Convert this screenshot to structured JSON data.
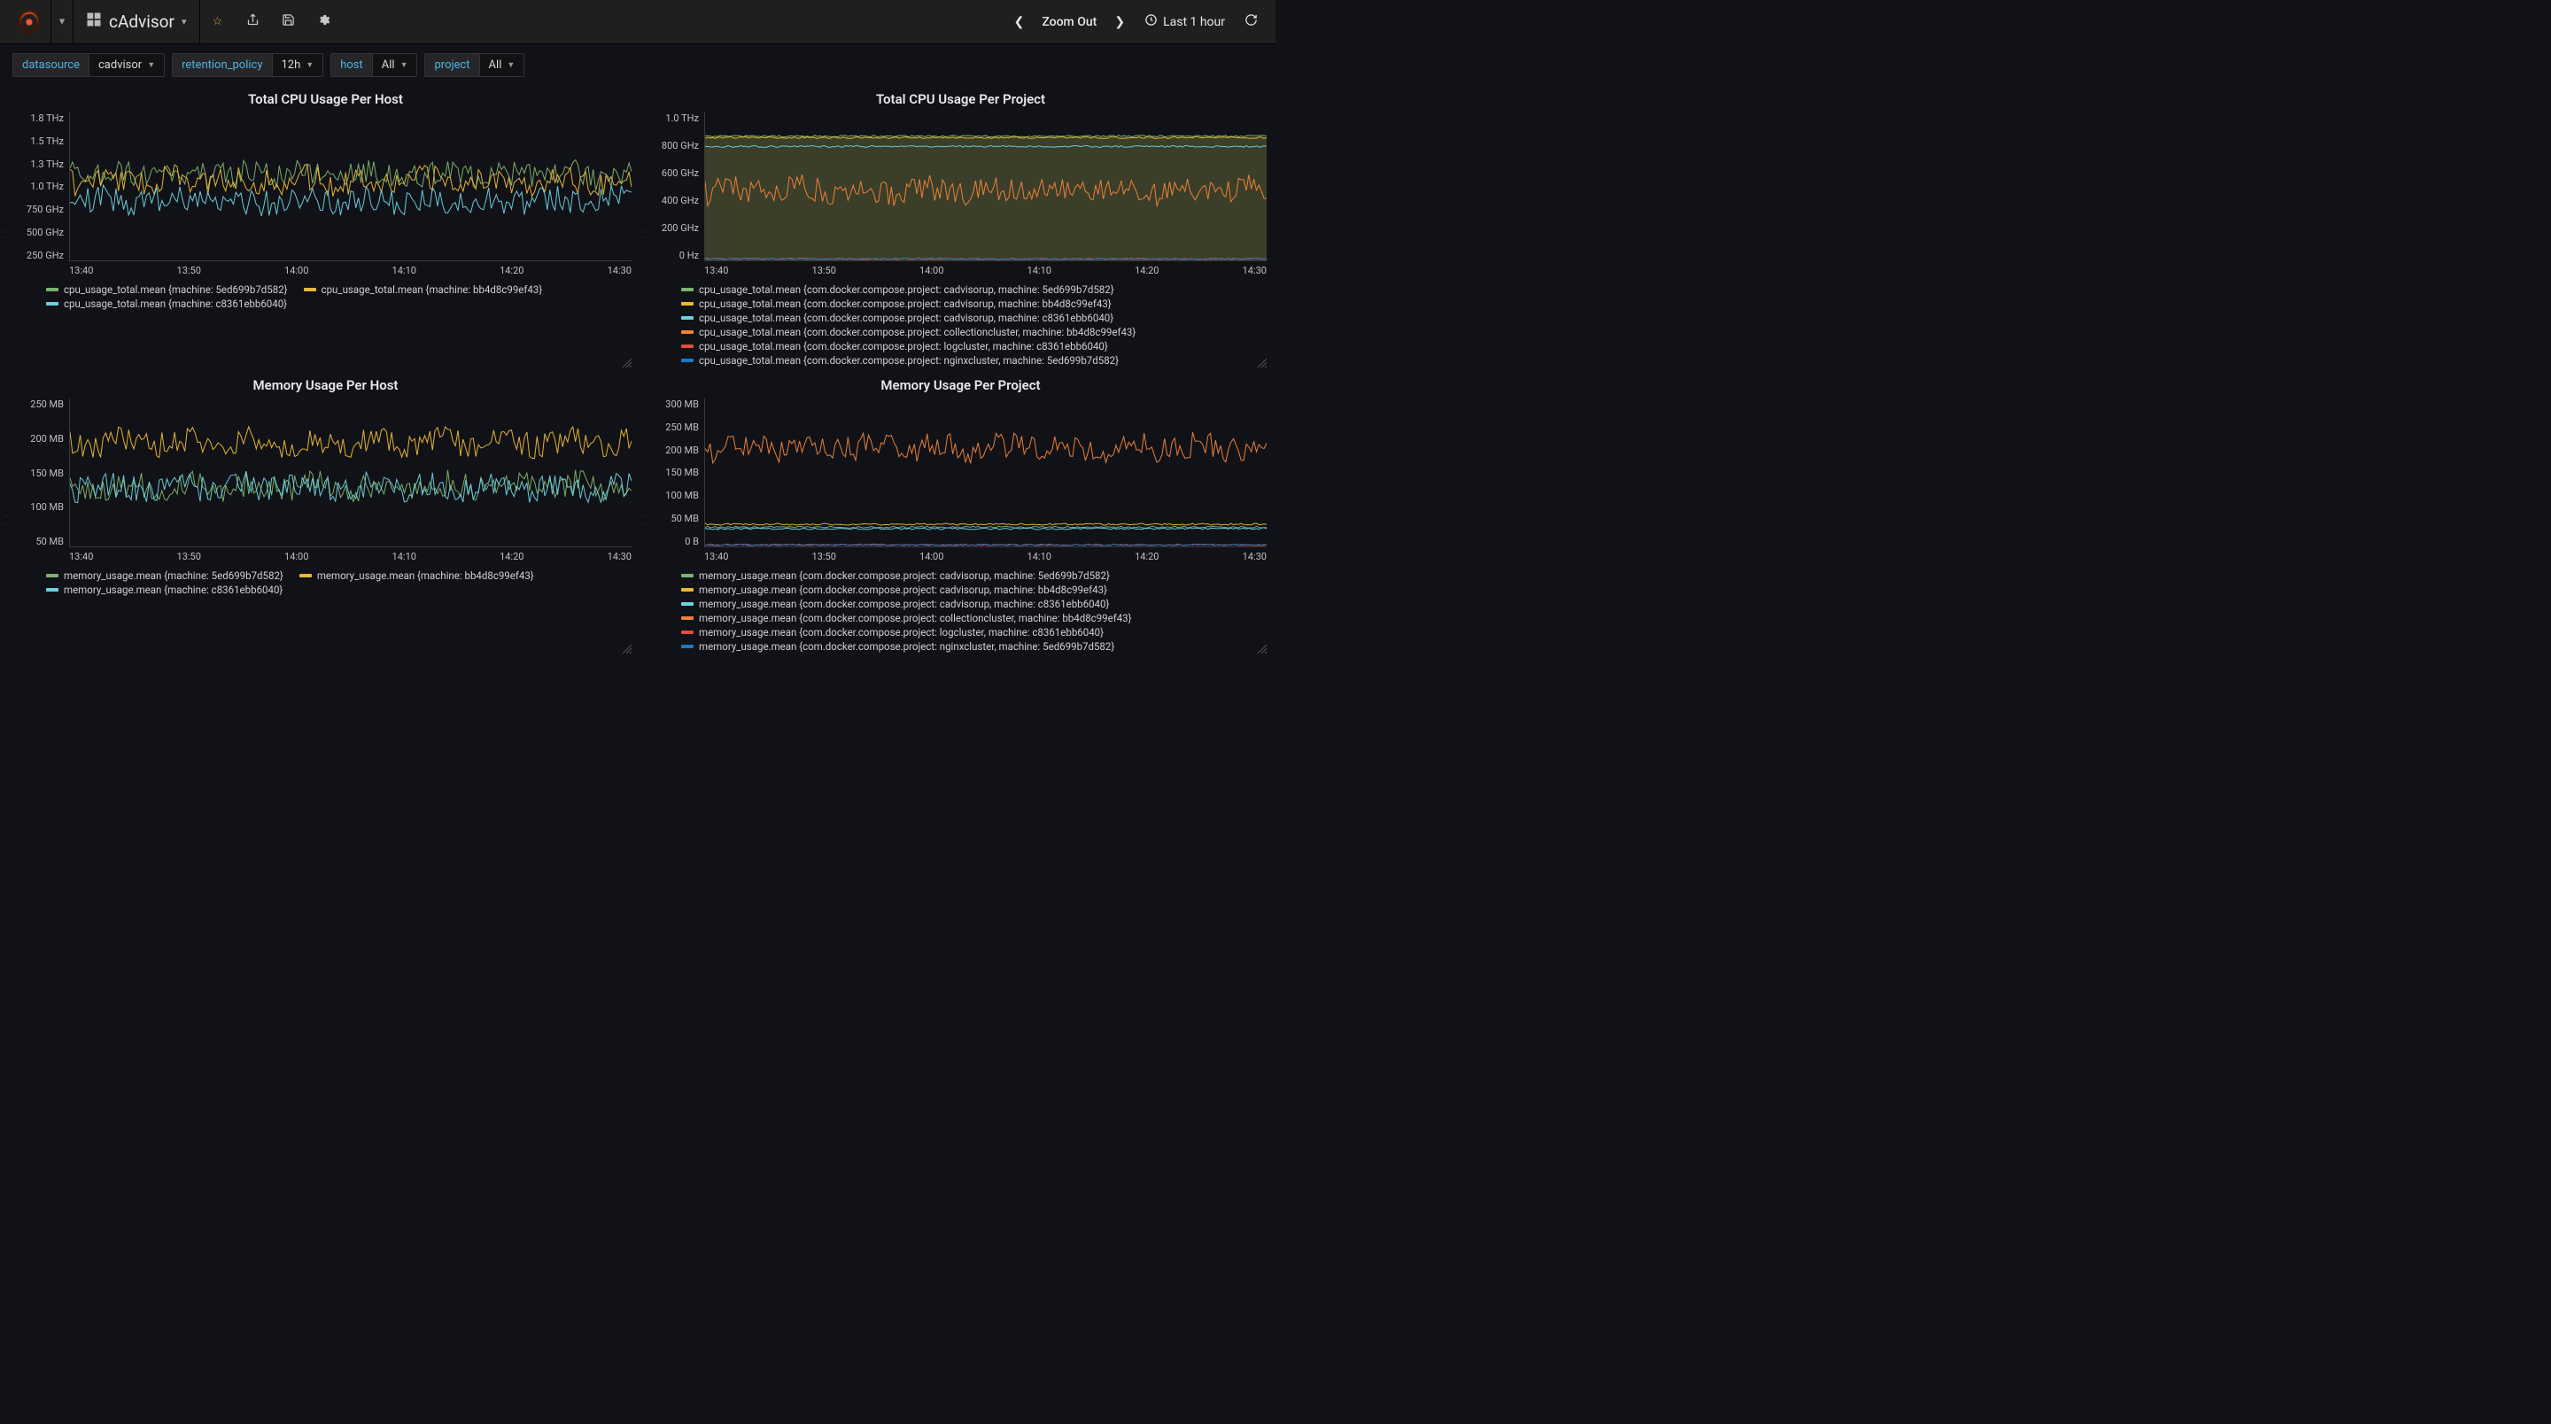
{
  "header": {
    "dashboard_title": "cAdvisor",
    "zoom_label": "Zoom Out",
    "time_label": "Last 1 hour"
  },
  "template_vars": [
    {
      "label": "datasource",
      "value": "cadvisor"
    },
    {
      "label": "retention_policy",
      "value": "12h"
    },
    {
      "label": "host",
      "value": "All"
    },
    {
      "label": "project",
      "value": "All"
    }
  ],
  "colors": {
    "green": "#7eb26d",
    "yellow": "#eab839",
    "cyan": "#6ed0e0",
    "orange": "#ef843c",
    "red": "#e24d42",
    "blue": "#1f78c1"
  },
  "panels": [
    {
      "title": "Total CPU Usage Per Host",
      "y_ticks": [
        "1.8 THz",
        "1.5 THz",
        "1.3 THz",
        "1.0 THz",
        "750 GHz",
        "500 GHz",
        "250 GHz"
      ],
      "x_ticks": [
        "13:40",
        "13:50",
        "14:00",
        "14:10",
        "14:20",
        "14:30"
      ],
      "legend": [
        {
          "color": "green",
          "text": "cpu_usage_total.mean {machine: 5ed699b7d582}"
        },
        {
          "color": "yellow",
          "text": "cpu_usage_total.mean {machine: bb4d8c99ef43}"
        },
        {
          "color": "cyan",
          "text": "cpu_usage_total.mean {machine: c8361ebb6040}"
        }
      ],
      "series_style": "noisy",
      "bases": {
        "green": 0.42,
        "yellow": 0.46,
        "cyan": 0.6
      },
      "fill": false,
      "height": 168
    },
    {
      "title": "Total CPU Usage Per Project",
      "y_ticks": [
        "1.0 THz",
        "800 GHz",
        "600 GHz",
        "400 GHz",
        "200 GHz",
        "0 Hz"
      ],
      "x_ticks": [
        "13:40",
        "13:50",
        "14:00",
        "14:10",
        "14:20",
        "14:30"
      ],
      "legend": [
        {
          "color": "green",
          "text": "cpu_usage_total.mean {com.docker.compose.project: cadvisorup, machine: 5ed699b7d582}"
        },
        {
          "color": "yellow",
          "text": "cpu_usage_total.mean {com.docker.compose.project: cadvisorup, machine: bb4d8c99ef43}"
        },
        {
          "color": "cyan",
          "text": "cpu_usage_total.mean {com.docker.compose.project: cadvisorup, machine: c8361ebb6040}"
        },
        {
          "color": "orange",
          "text": "cpu_usage_total.mean {com.docker.compose.project: collectioncluster, machine: bb4d8c99ef43}"
        },
        {
          "color": "red",
          "text": "cpu_usage_total.mean {com.docker.compose.project: logcluster, machine: c8361ebb6040}"
        },
        {
          "color": "blue",
          "text": "cpu_usage_total.mean {com.docker.compose.project: nginxcluster, machine: 5ed699b7d582}"
        }
      ],
      "series_style": "flat_with_noisy_orange",
      "bases": {
        "green": 0.16,
        "yellow": 0.17,
        "cyan": 0.23,
        "orange": 0.53,
        "red": 0.99,
        "blue": 0.99
      },
      "fill": true,
      "height": 168
    },
    {
      "title": "Memory Usage Per Host",
      "y_ticks": [
        "250 MB",
        "200 MB",
        "150 MB",
        "100 MB",
        "50 MB"
      ],
      "x_ticks": [
        "13:40",
        "13:50",
        "14:00",
        "14:10",
        "14:20",
        "14:30"
      ],
      "legend": [
        {
          "color": "green",
          "text": "memory_usage.mean {machine: 5ed699b7d582}"
        },
        {
          "color": "yellow",
          "text": "memory_usage.mean {machine: bb4d8c99ef43}"
        },
        {
          "color": "cyan",
          "text": "memory_usage.mean {machine: c8361ebb6040}"
        }
      ],
      "series_style": "noisy",
      "bases": {
        "green": 0.59,
        "yellow": 0.3,
        "cyan": 0.6
      },
      "fill": false,
      "height": 168
    },
    {
      "title": "Memory Usage Per Project",
      "y_ticks": [
        "300 MB",
        "250 MB",
        "200 MB",
        "150 MB",
        "100 MB",
        "50 MB",
        "0 B"
      ],
      "x_ticks": [
        "13:40",
        "13:50",
        "14:00",
        "14:10",
        "14:20",
        "14:30"
      ],
      "legend": [
        {
          "color": "green",
          "text": "memory_usage.mean {com.docker.compose.project: cadvisorup, machine: 5ed699b7d582}"
        },
        {
          "color": "yellow",
          "text": "memory_usage.mean {com.docker.compose.project: cadvisorup, machine: bb4d8c99ef43}"
        },
        {
          "color": "cyan",
          "text": "memory_usage.mean {com.docker.compose.project: cadvisorup, machine: c8361ebb6040}"
        },
        {
          "color": "orange",
          "text": "memory_usage.mean {com.docker.compose.project: collectioncluster, machine: bb4d8c99ef43}"
        },
        {
          "color": "red",
          "text": "memory_usage.mean {com.docker.compose.project: logcluster, machine: c8361ebb6040}"
        },
        {
          "color": "blue",
          "text": "memory_usage.mean {com.docker.compose.project: nginxcluster, machine: 5ed699b7d582}"
        }
      ],
      "series_style": "flat_with_noisy_orange",
      "bases": {
        "green": 0.87,
        "yellow": 0.85,
        "cyan": 0.88,
        "orange": 0.33,
        "red": 0.99,
        "blue": 0.99
      },
      "fill": false,
      "height": 168
    }
  ],
  "chart_data": [
    {
      "title": "Total CPU Usage Per Host",
      "type": "line",
      "xlabel": "",
      "ylabel": "",
      "x_unit": "time",
      "y_unit": "Hz",
      "ylim_ghz": [
        250,
        1800
      ],
      "x": [
        "13:40",
        "13:50",
        "14:00",
        "14:10",
        "14:20",
        "14:30"
      ],
      "series": [
        {
          "name": "cpu_usage_total.mean {machine: 5ed699b7d582}",
          "approx_mean_ghz": 1150,
          "noisy": true
        },
        {
          "name": "cpu_usage_total.mean {machine: bb4d8c99ef43}",
          "approx_mean_ghz": 1100,
          "noisy": true
        },
        {
          "name": "cpu_usage_total.mean {machine: c8361ebb6040}",
          "approx_mean_ghz": 850,
          "noisy": true
        }
      ]
    },
    {
      "title": "Total CPU Usage Per Project",
      "type": "area",
      "xlabel": "",
      "ylabel": "",
      "x_unit": "time",
      "y_unit": "Hz",
      "ylim_ghz": [
        0,
        1000
      ],
      "x": [
        "13:40",
        "13:50",
        "14:00",
        "14:10",
        "14:20",
        "14:30"
      ],
      "series": [
        {
          "name": "cadvisorup @ 5ed699b7d582",
          "approx_mean_ghz": 840,
          "flat": true
        },
        {
          "name": "cadvisorup @ bb4d8c99ef43",
          "approx_mean_ghz": 830,
          "flat": true
        },
        {
          "name": "cadvisorup @ c8361ebb6040",
          "approx_mean_ghz": 770,
          "flat": true
        },
        {
          "name": "collectioncluster @ bb4d8c99ef43",
          "approx_mean_ghz": 480,
          "noisy": true
        },
        {
          "name": "logcluster @ c8361ebb6040",
          "approx_mean_ghz": 5,
          "flat": true
        },
        {
          "name": "nginxcluster @ 5ed699b7d582",
          "approx_mean_ghz": 5,
          "flat": true
        }
      ]
    },
    {
      "title": "Memory Usage Per Host",
      "type": "line",
      "xlabel": "",
      "ylabel": "",
      "x_unit": "time",
      "y_unit": "bytes",
      "ylim_mb": [
        50,
        250
      ],
      "x": [
        "13:40",
        "13:50",
        "14:00",
        "14:10",
        "14:20",
        "14:30"
      ],
      "series": [
        {
          "name": "memory_usage.mean {machine: 5ed699b7d582}",
          "approx_mean_mb": 130,
          "noisy": true
        },
        {
          "name": "memory_usage.mean {machine: bb4d8c99ef43}",
          "approx_mean_mb": 190,
          "noisy": true
        },
        {
          "name": "memory_usage.mean {machine: c8361ebb6040}",
          "approx_mean_mb": 125,
          "noisy": true
        }
      ]
    },
    {
      "title": "Memory Usage Per Project",
      "type": "line",
      "xlabel": "",
      "ylabel": "",
      "x_unit": "time",
      "y_unit": "bytes",
      "ylim_mb": [
        0,
        300
      ],
      "x": [
        "13:40",
        "13:50",
        "14:00",
        "14:10",
        "14:20",
        "14:30"
      ],
      "series": [
        {
          "name": "cadvisorup @ 5ed699b7d582",
          "approx_mean_mb": 40,
          "flat": true
        },
        {
          "name": "cadvisorup @ bb4d8c99ef43",
          "approx_mean_mb": 45,
          "flat": true
        },
        {
          "name": "cadvisorup @ c8361ebb6040",
          "approx_mean_mb": 38,
          "flat": true
        },
        {
          "name": "collectioncluster @ bb4d8c99ef43",
          "approx_mean_mb": 200,
          "noisy": true
        },
        {
          "name": "logcluster @ c8361ebb6040",
          "approx_mean_mb": 3,
          "flat": true
        },
        {
          "name": "nginxcluster @ 5ed699b7d582",
          "approx_mean_mb": 3,
          "flat": true
        }
      ]
    }
  ]
}
